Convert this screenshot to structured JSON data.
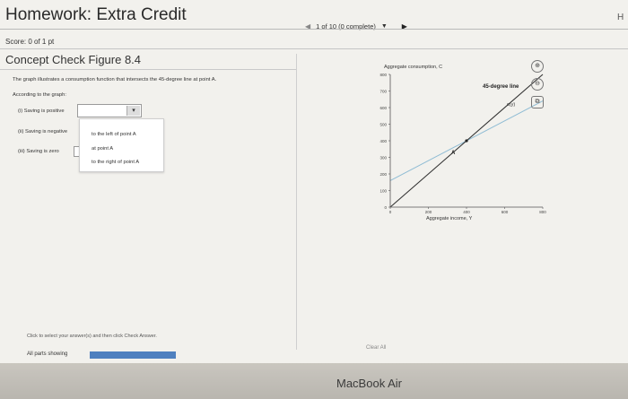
{
  "header": {
    "title": "Homework: Extra Credit",
    "right_edge": "H",
    "pager_text": "1 of 10 (0 complete)",
    "score": "Score: 0 of 1 pt"
  },
  "question": {
    "title": "Concept Check Figure 8.4",
    "prompt": "The graph illustrates a consumption function that intersects the 45-degree line at point A.",
    "according": "According to the graph:",
    "items": [
      {
        "label": "(i) Saving is positive"
      },
      {
        "label": "(ii) Saving is negative"
      },
      {
        "label": "(iii) Saving is zero"
      }
    ],
    "dropdown_options": [
      "to the left of point A",
      "at point A",
      "to the right of point A"
    ]
  },
  "footer": {
    "instructions": "Click to select your answer(s) and then click Check Answer.",
    "all_parts": "All parts showing",
    "clear_all": "Clear All"
  },
  "bezel": {
    "brand": "MacBook Air"
  },
  "chart_data": {
    "type": "line",
    "ylabel": "Aggregate consumption, C",
    "xlabel": "Aggregate income, Y",
    "xlim": [
      0,
      800
    ],
    "ylim": [
      0,
      800
    ],
    "xticks": [
      "0",
      "200",
      "400",
      "600",
      "800"
    ],
    "yticks": [
      "0",
      "100",
      "200",
      "300",
      "400",
      "500",
      "600",
      "700",
      "800"
    ],
    "series": [
      {
        "name": "45-degree line",
        "points": [
          [
            0,
            0
          ],
          [
            800,
            800
          ]
        ],
        "color": "#333333"
      },
      {
        "name": "c(y)",
        "points": [
          [
            0,
            160
          ],
          [
            800,
            640
          ]
        ],
        "color": "#8fbcd4"
      }
    ],
    "annotations": [
      {
        "label": "A",
        "x": 400,
        "y": 400
      }
    ]
  }
}
